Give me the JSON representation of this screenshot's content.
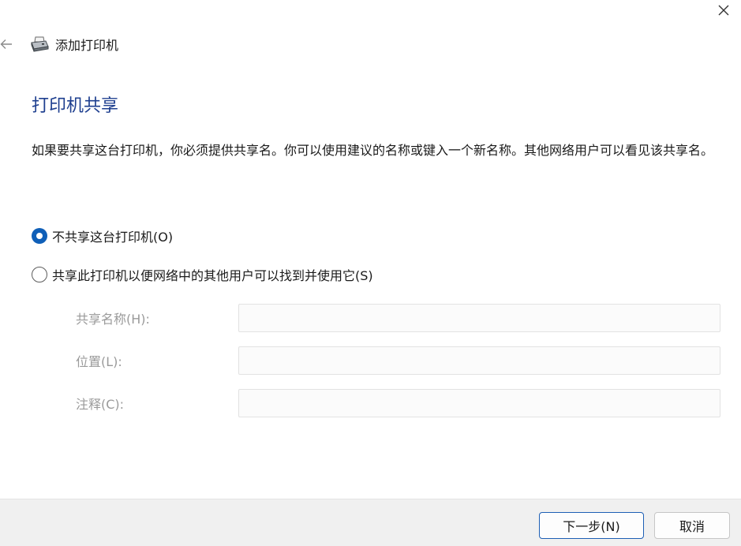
{
  "window": {
    "title": "添加打印机",
    "close_glyph": "✕",
    "back_glyph": "←"
  },
  "page": {
    "heading": "打印机共享",
    "description": "如果要共享这台打印机，你必须提供共享名。你可以使用建议的名称或键入一个新名称。其他网络用户可以看见该共享名。"
  },
  "sharing_options": [
    {
      "label": "不共享这台打印机(O)",
      "checked": true
    },
    {
      "label": "共享此打印机以便网络中的其他用户可以找到并使用它(S)",
      "checked": false
    }
  ],
  "fields": {
    "share_name": {
      "label": "共享名称(H):",
      "value": ""
    },
    "location": {
      "label": "位置(L):",
      "value": ""
    },
    "comment": {
      "label": "注释(C):",
      "value": ""
    }
  },
  "footer": {
    "next_label": "下一步(N)",
    "cancel_label": "取消"
  },
  "colors": {
    "accent": "#0f5fb8",
    "heading": "#1e3f8f",
    "disabled_text": "#9a9a9a",
    "footer_bg": "#f0f0f0"
  },
  "icons": {
    "close": "close-icon",
    "back": "back-arrow-icon",
    "app": "printer-icon"
  }
}
